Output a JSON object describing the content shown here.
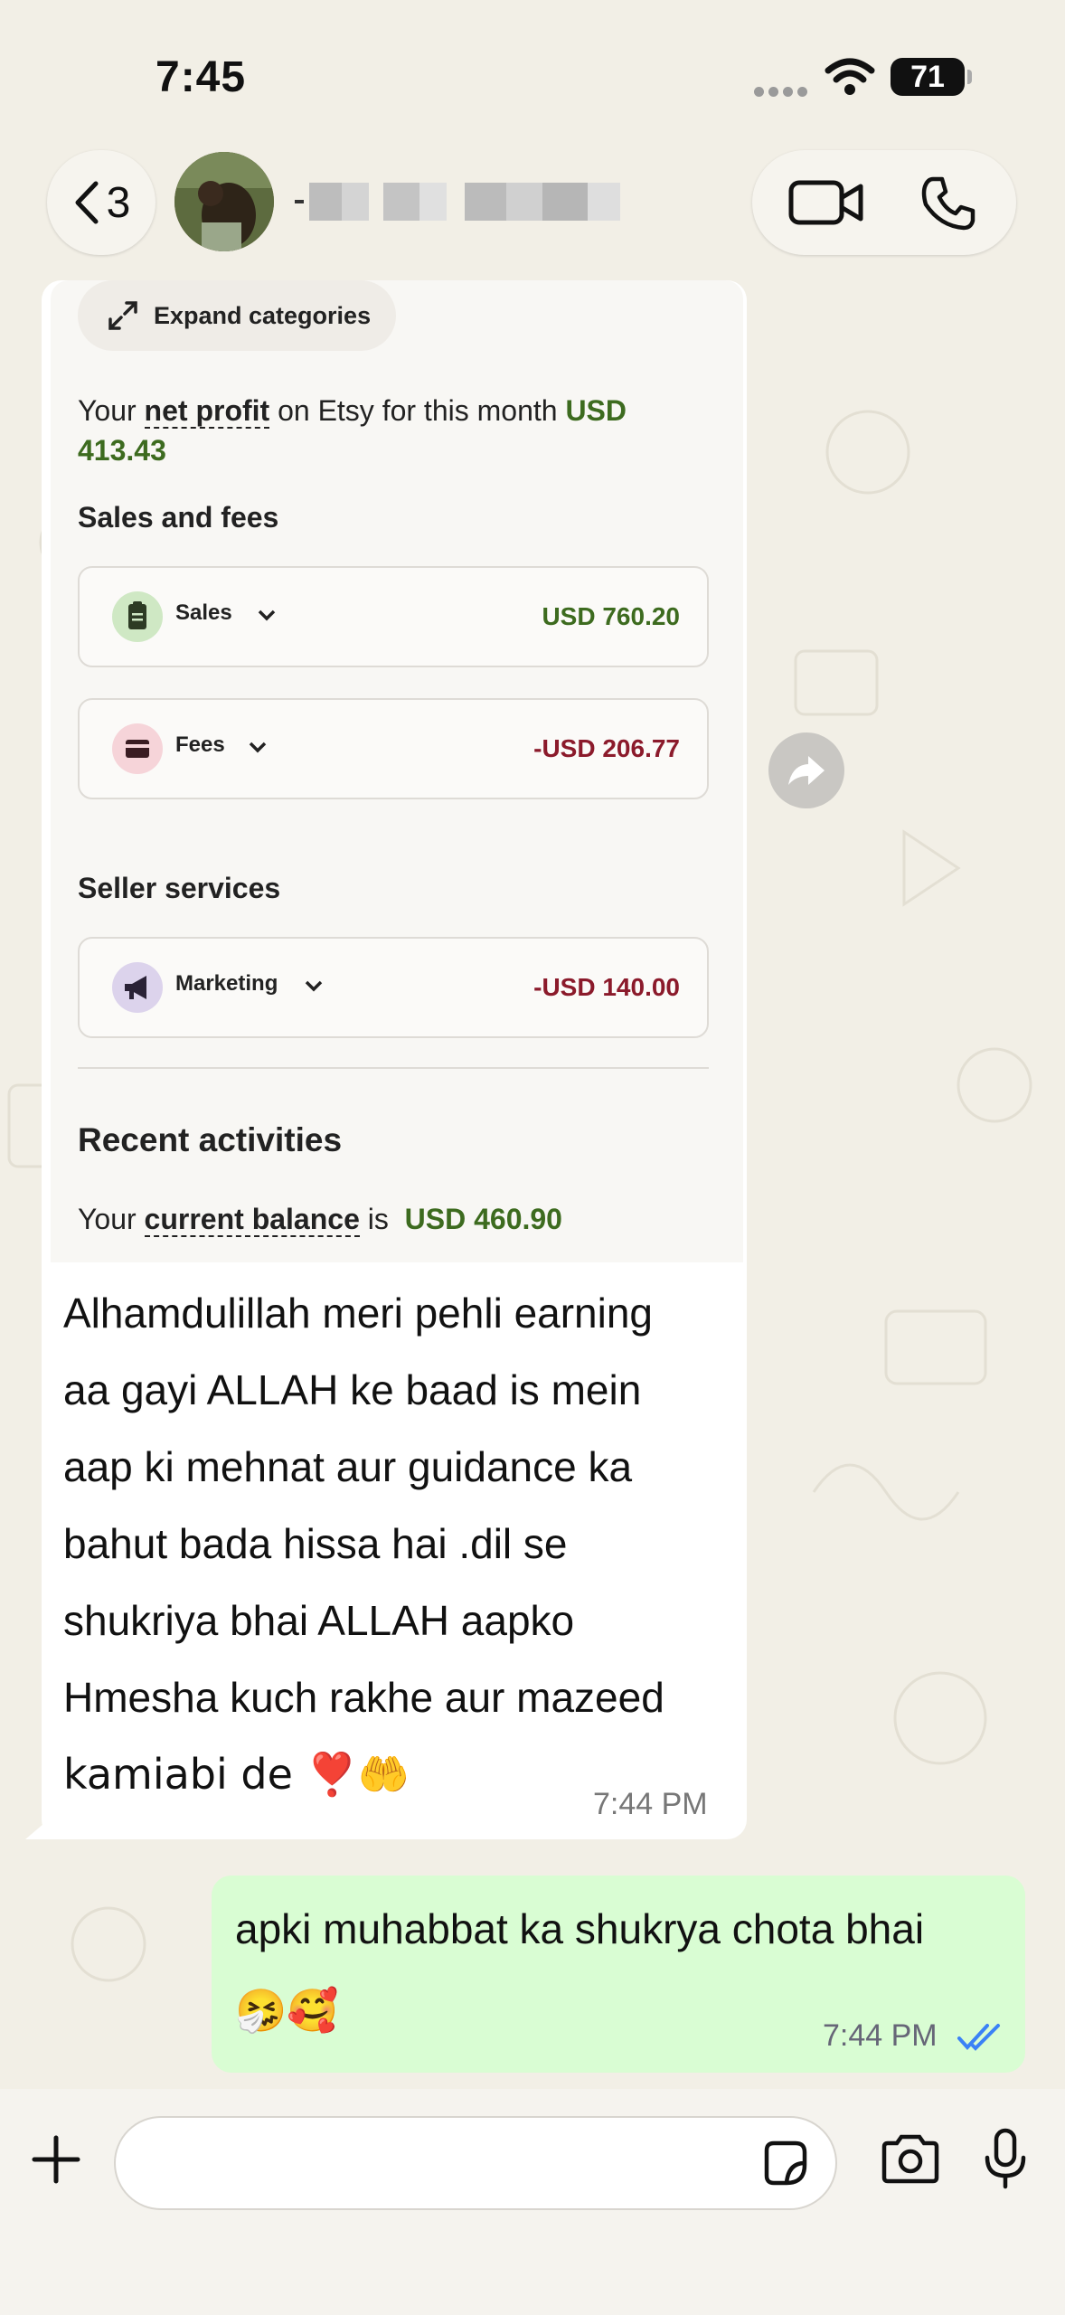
{
  "status_bar": {
    "time": "7:45",
    "battery": "71"
  },
  "header": {
    "back_count": "3",
    "contact_name": "- ▓▓ ▓▓▓ ▓▓▓▓▓",
    "icons": [
      "chevron-left-icon",
      "avatar",
      "video-call-icon",
      "phone-call-icon"
    ]
  },
  "shared_screenshot": {
    "expand_label": "Expand categories",
    "profit_prefix": "Your ",
    "profit_link": "net profit",
    "profit_middle": " on Etsy for this month ",
    "profit_amount": "USD 413.43",
    "sales_fees_heading": "Sales and fees",
    "rows": [
      {
        "label": "Sales",
        "amount": "USD 760.20",
        "color": "#3d6b1f",
        "icon": "clipboard-icon"
      },
      {
        "label": "Fees",
        "amount": "-USD 206.77",
        "color": "#8b1a2b",
        "icon": "credit-card-icon"
      }
    ],
    "seller_services_heading": "Seller services",
    "marketing": {
      "label": "Marketing",
      "amount": "-USD 140.00",
      "icon": "megaphone-icon"
    },
    "recent_heading": "Recent activities",
    "balance_prefix": "Your ",
    "balance_link": "current balance",
    "balance_mid": " is ",
    "balance_amount": "USD 460.90"
  },
  "incoming_message": {
    "lines": [
      "Alhamdulillah meri pehli earning",
      "aa gayi ALLAH ke baad is mein",
      "aap ki mehnat aur guidance ka",
      "bahut bada hissa hai .dil se",
      "shukriya bhai ALLAH aapko",
      "Hmesha kuch rakhe aur mazeed",
      "kamiabi de ❣️🤲"
    ],
    "time": "7:44 PM"
  },
  "outgoing_message": {
    "line1": "apki muhabbat ka shukrya chota bhai",
    "line2": "🤧🥰",
    "time": "7:44 PM",
    "status": "read-double-check-icon"
  },
  "input": {
    "placeholder": ""
  },
  "colors": {
    "outgoing_bubble": "#d9fdd3",
    "incoming_bubble": "#ffffff",
    "read_ticks": "#3b82f6",
    "profit_green": "#3d6b1f",
    "fee_red": "#8b1a2b"
  }
}
